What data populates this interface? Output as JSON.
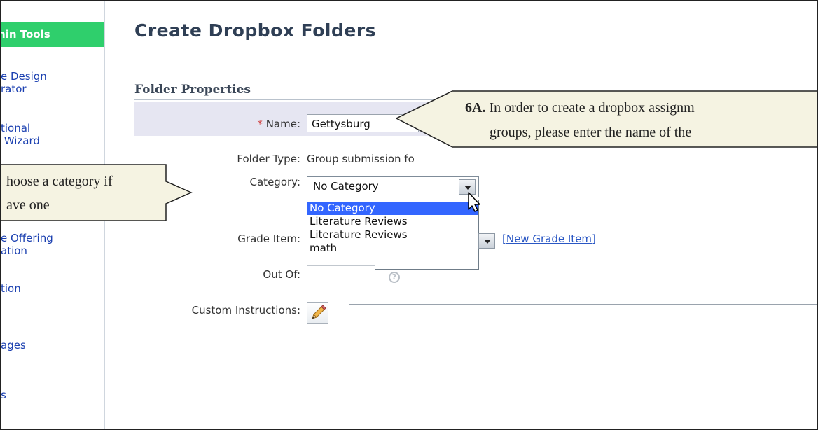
{
  "sidebar": {
    "header": "hin Tools",
    "items": [
      {
        "label": "e Design\nrator"
      },
      {
        "label": "tional\n Wizard"
      },
      {
        "label": "e Offering\nation"
      },
      {
        "label": "tion"
      },
      {
        "label": "ages"
      },
      {
        "label": "s"
      }
    ]
  },
  "page": {
    "title": "Create Dropbox Folders",
    "section_title": "Folder Properties"
  },
  "form": {
    "required_marker": "*",
    "name_label": "Name:",
    "name_value": "Gettysburg",
    "folder_type_label": "Folder Type:",
    "folder_type_value": "Group submission fo",
    "category_label": "Category:",
    "category_value": "No Category",
    "category_options": [
      "No Category",
      "Literature Reviews",
      "Literature Reviews",
      "math"
    ],
    "grade_item_label": "Grade Item:",
    "new_grade_item_link": "[New Grade Item]",
    "out_of_label": "Out Of:",
    "help_icon_glyph": "?",
    "custom_instructions_label": "Custom Instructions:"
  },
  "callouts": {
    "name_callout": {
      "bold": "6A.",
      "line1": " In order to create a dropbox assignm",
      "line2": "groups, please enter the name of the"
    },
    "category_callout": {
      "line1": "hoose a category if",
      "line2": "ave one"
    }
  },
  "colors": {
    "sidebar_header_bg": "#2fcf6c",
    "selected_option_bg": "#3366ff",
    "link": "#2a57c4",
    "callout_bg": "#f5f3e2"
  },
  "icons": {
    "pencil": "pencil-icon",
    "help": "help-icon",
    "cursor": "mouse-pointer-icon",
    "dropdown": "chevron-down-icon"
  }
}
